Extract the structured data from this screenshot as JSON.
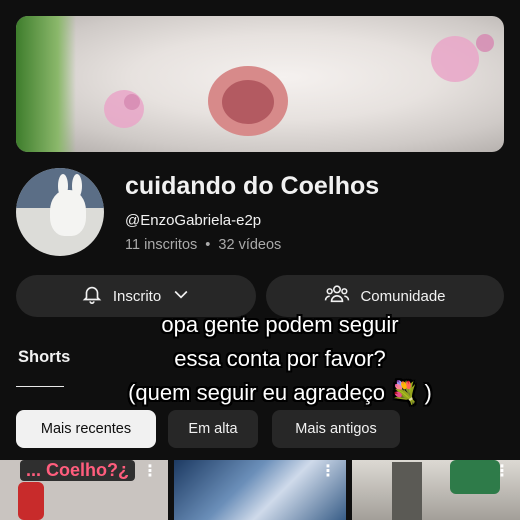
{
  "channel": {
    "name": "cuidando do Coelhos",
    "handle": "@EnzoGabriela-e2p",
    "subscribers": "11 inscritos",
    "separator": "•",
    "videos": "32 vídeos"
  },
  "actions": {
    "subscribed_label": "Inscrito",
    "community_label": "Comunidade"
  },
  "tabs": {
    "shorts": "Shorts"
  },
  "filters": [
    {
      "label": "Mais recentes",
      "active": true
    },
    {
      "label": "Em alta",
      "active": false
    },
    {
      "label": "Mais antigos",
      "active": false
    }
  ],
  "thumbnails": [
    {
      "caption": "... Coelho?¿",
      "menu": "⋮"
    },
    {
      "caption": "",
      "menu": "⋮"
    },
    {
      "caption": "",
      "menu": "⋮"
    }
  ],
  "overlay_text": [
    "opa gente podem seguir",
    "essa conta por favor?",
    "(quem seguir eu agradeço 💐 )"
  ],
  "icons": {
    "bell": "bell-icon",
    "chevron": "chevron-down-icon",
    "community": "people-icon",
    "menu": "more-vert-icon"
  }
}
